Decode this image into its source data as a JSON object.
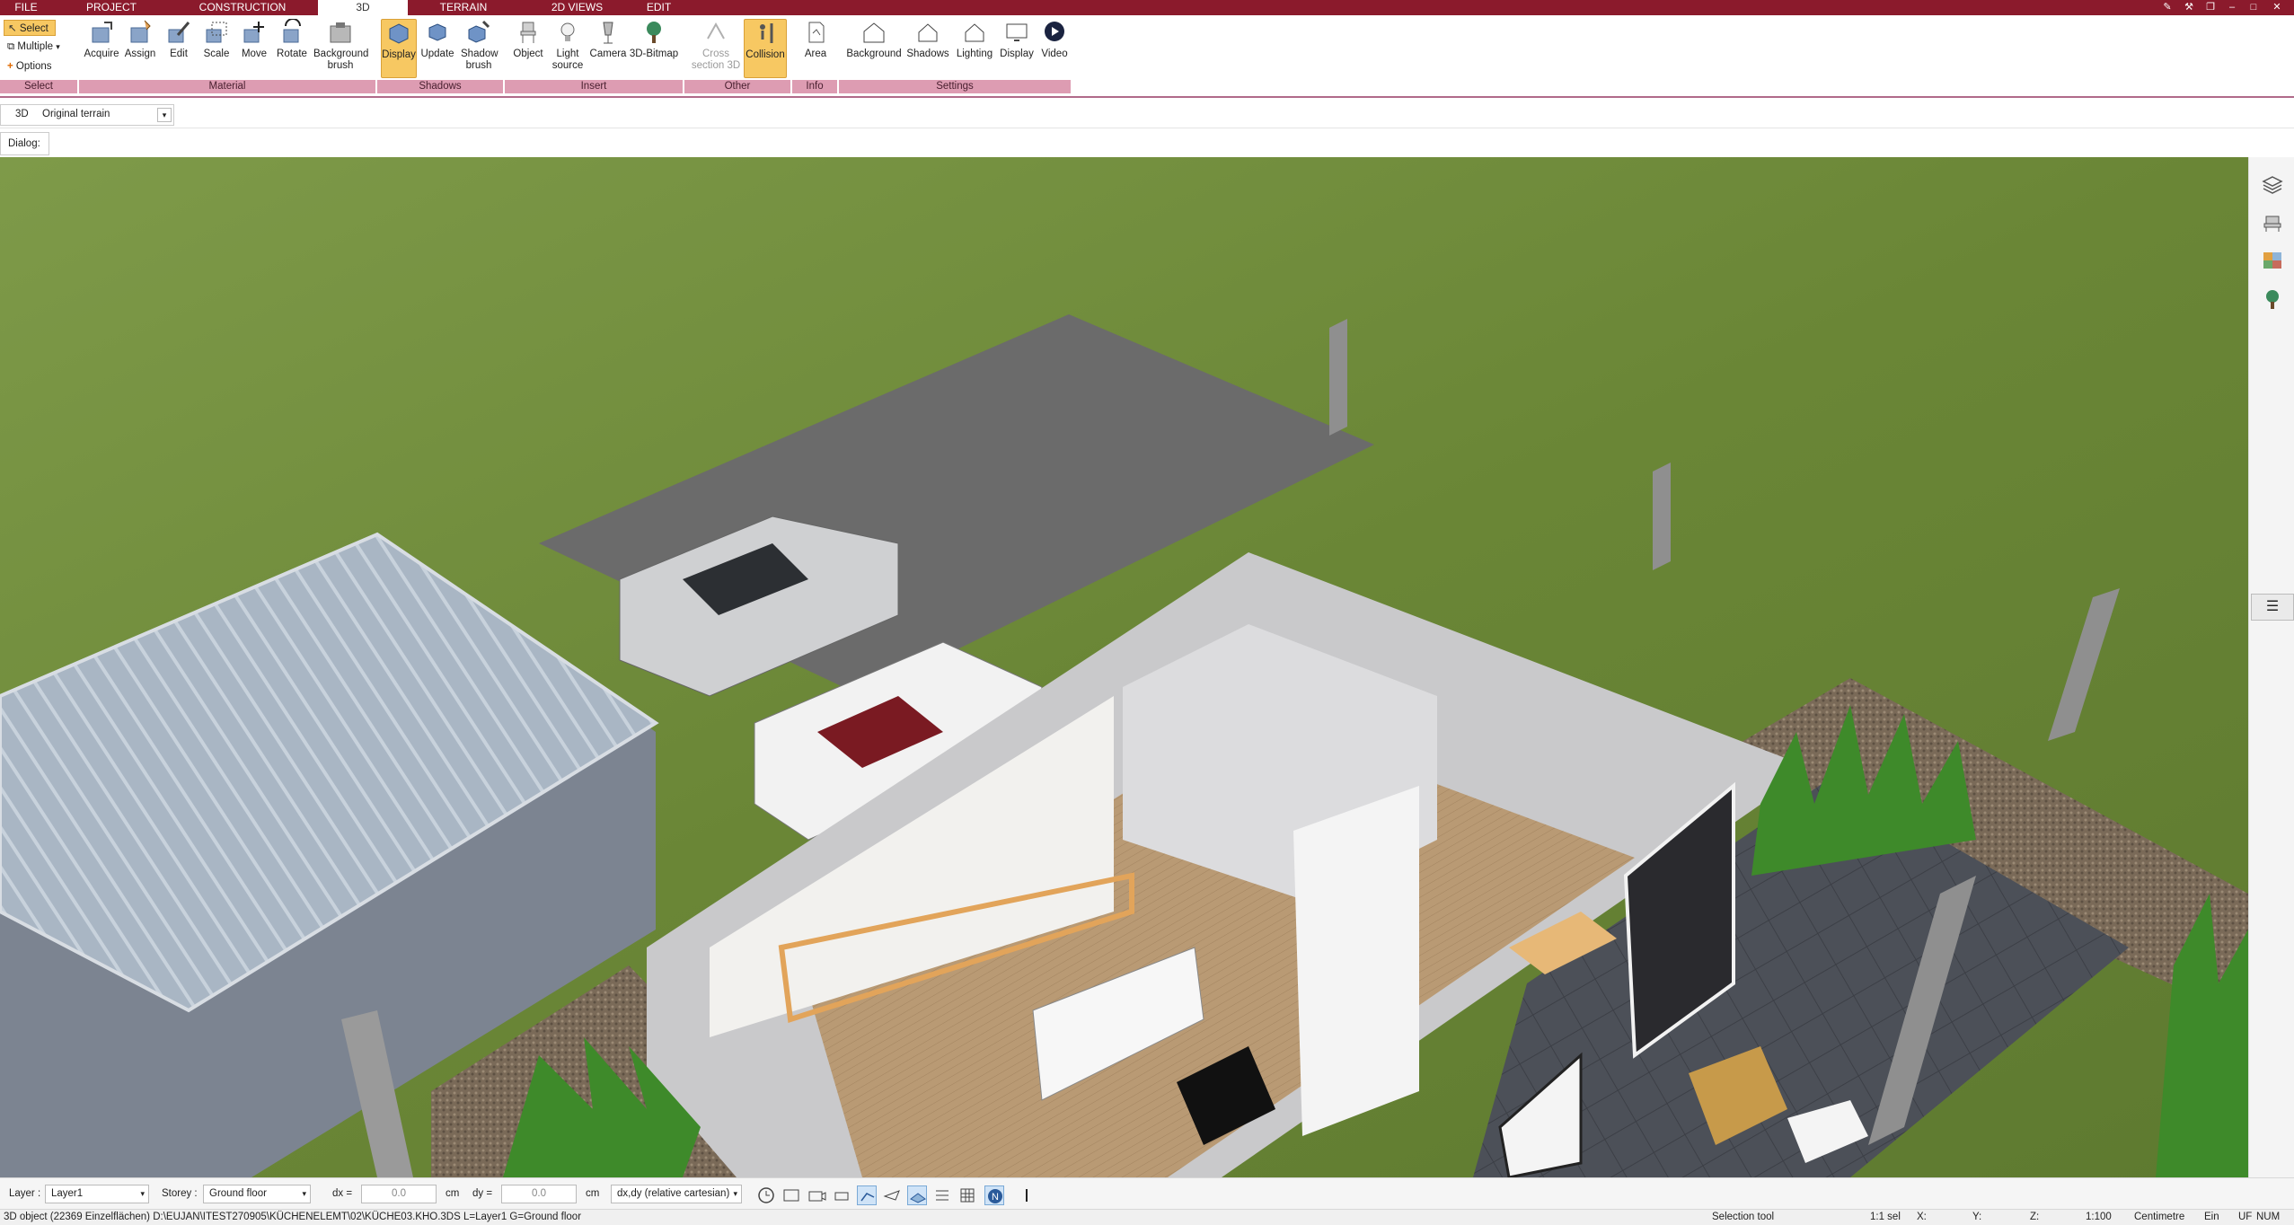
{
  "tabs": [
    {
      "label": "FILE",
      "active": false
    },
    {
      "label": "PROJECT",
      "active": false
    },
    {
      "label": "CONSTRUCTION",
      "active": false
    },
    {
      "label": "3D",
      "active": true
    },
    {
      "label": "TERRAIN",
      "active": false
    },
    {
      "label": "2D VIEWS",
      "active": false
    },
    {
      "label": "EDIT",
      "active": false
    }
  ],
  "ribbon": {
    "select": {
      "select_label": "Select",
      "multiple_label": "Multiple",
      "options_label": "Options",
      "group": "Select"
    },
    "material": {
      "group": "Material",
      "buttons": [
        "Acquire",
        "Assign",
        "Edit",
        "Scale",
        "Move",
        "Rotate",
        "Background brush"
      ]
    },
    "shadows": {
      "group": "Shadows",
      "buttons": [
        "Display",
        "Update",
        "Shadow brush"
      ]
    },
    "insert": {
      "group": "Insert",
      "buttons": [
        "Object",
        "Light source",
        "Camera",
        "3D-Bitmap"
      ]
    },
    "other": {
      "group": "Other",
      "buttons": [
        "Cross section 3D",
        "Collision"
      ]
    },
    "info": {
      "group": "Info",
      "buttons": [
        "Area"
      ]
    },
    "settings": {
      "group": "Settings",
      "buttons": [
        "Background",
        "Shadows",
        "Lighting",
        "Display",
        "Video"
      ]
    }
  },
  "view_bar": {
    "mode": "3D",
    "terrain_select": "Original terrain"
  },
  "dialog_label": "Dialog:",
  "layer_bar": {
    "layer_label": "Layer :",
    "layer_value": "Layer1",
    "storey_label": "Storey :",
    "storey_value": "Ground floor",
    "dx_label": "dx =",
    "dx_value": "0.0",
    "dx_unit": "cm",
    "dy_label": "dy =",
    "dy_value": "0.0",
    "dy_unit": "cm",
    "coord_mode": "dx,dy (relative cartesian)"
  },
  "status": {
    "message": "3D object (22369 Einzelflächen) D:\\EUJAN\\ITEST270905\\KÜCHENELEMT\\02\\KÜCHE03.KHO.3DS L=Layer1 G=Ground floor",
    "tool": "Selection tool",
    "sel": "1:1 sel",
    "x": "X:",
    "y": "Y:",
    "z": "Z:",
    "scale": "1:100",
    "unit": "Centimetre",
    "ein": "Ein",
    "uf": "UF",
    "num": "NUM"
  },
  "colors": {
    "accent": "#8b1a2c",
    "group_band": "#dd9cb2",
    "highlight": "#f7c862",
    "grass": "#6f8a3c"
  }
}
